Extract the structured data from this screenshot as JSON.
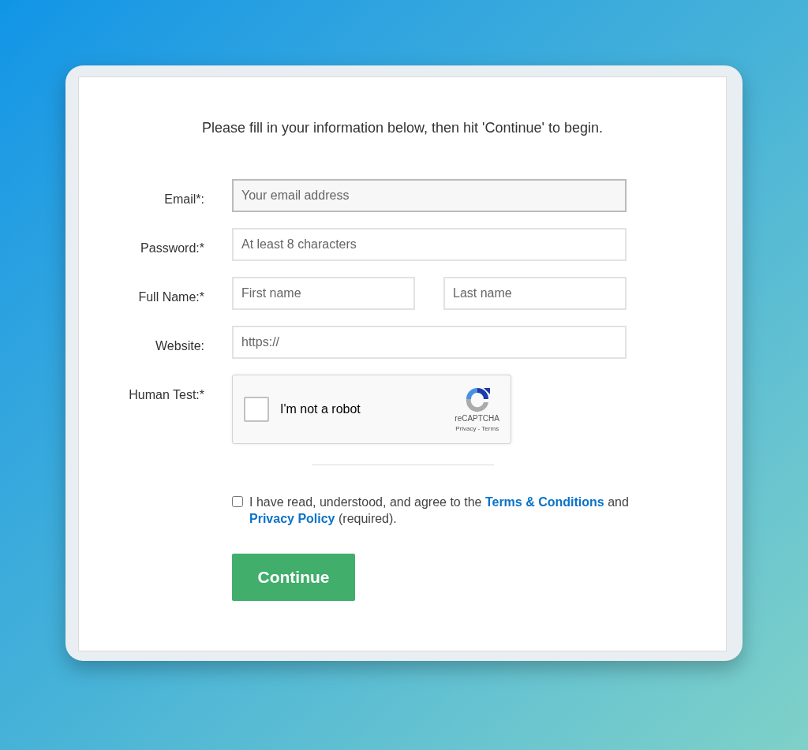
{
  "intro": "Please fill in your information below, then hit 'Continue' to begin.",
  "rows": [
    {
      "kind": "fields",
      "label": "Email*:",
      "fields": [
        {
          "placeholder": "Your email address",
          "focused": true
        }
      ]
    },
    {
      "kind": "fields",
      "label": "Password:*",
      "fields": [
        {
          "placeholder": "At least 8 characters",
          "focused": false
        }
      ]
    },
    {
      "kind": "fields",
      "label": "Full Name:*",
      "fields": [
        {
          "placeholder": "First name",
          "focused": false
        },
        {
          "placeholder": "Last name",
          "focused": false
        }
      ]
    },
    {
      "kind": "fields",
      "label": "Website:",
      "fields": [
        {
          "placeholder": "https://",
          "focused": false
        }
      ]
    },
    {
      "kind": "captcha",
      "label": "Human Test:*",
      "captcha": {
        "checked": false,
        "text": "I'm not a robot",
        "brand": "reCAPTCHA",
        "links": "Privacy - Terms"
      }
    }
  ],
  "agreement": {
    "checked": false,
    "parts": [
      {
        "kind": "text",
        "text": "I have read, understood, and agree to the"
      },
      {
        "kind": "link",
        "text": "Terms & Conditions"
      },
      {
        "kind": "text",
        "text": "and"
      },
      {
        "kind": "link",
        "text": "Privacy Policy"
      },
      {
        "kind": "text",
        "text": "(required)."
      }
    ]
  },
  "button": "Continue"
}
